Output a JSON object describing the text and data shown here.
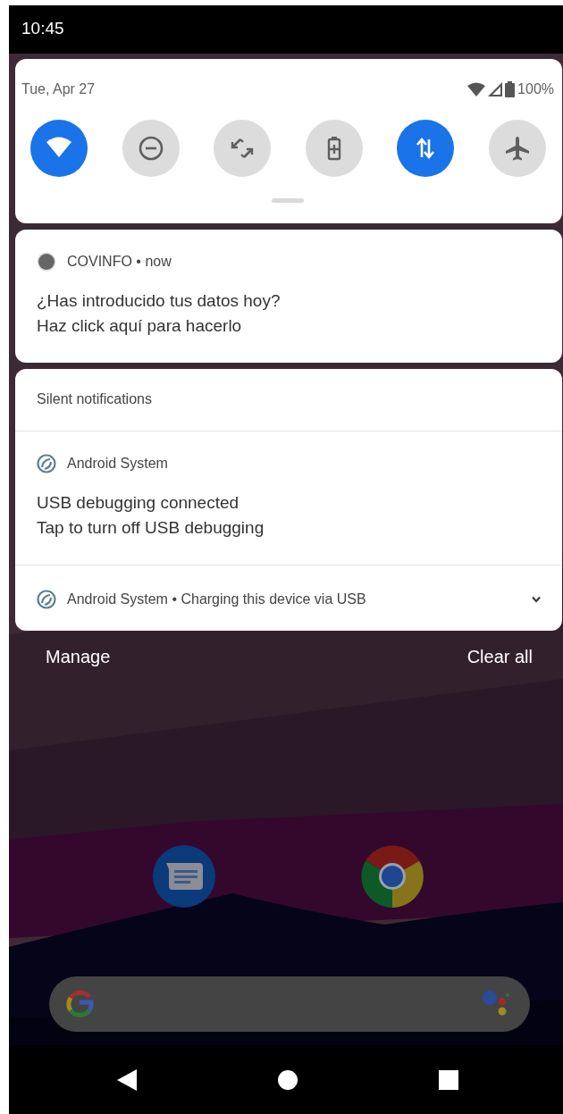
{
  "status_bar": {
    "time": "10:45"
  },
  "quick_settings": {
    "date": "Tue, Apr 27",
    "battery": "100%",
    "tiles": [
      {
        "kind": "wifi",
        "on": true
      },
      {
        "kind": "dnd",
        "on": false
      },
      {
        "kind": "rotate",
        "on": false
      },
      {
        "kind": "battery_saver",
        "on": false
      },
      {
        "kind": "data",
        "on": true
      },
      {
        "kind": "airplane",
        "on": false
      }
    ]
  },
  "notifications": [
    {
      "kind": "app",
      "header": "COVINFO • now",
      "title": "¿Has introducido tus datos hoy?",
      "text": "Haz click aquí para hacerlo"
    }
  ],
  "silent": {
    "header": "Silent notifications",
    "items": [
      {
        "kind": "full",
        "header": "Android System",
        "title": "USB debugging connected",
        "text": "Tap to turn off USB debugging"
      },
      {
        "kind": "collapsed",
        "header": "Android System • Charging this device via USB",
        "expanded": false
      }
    ]
  },
  "actions": [
    "Manage",
    "Clear all"
  ],
  "home_apps": [
    {
      "kind": "messages"
    },
    {
      "kind": "browser"
    }
  ]
}
